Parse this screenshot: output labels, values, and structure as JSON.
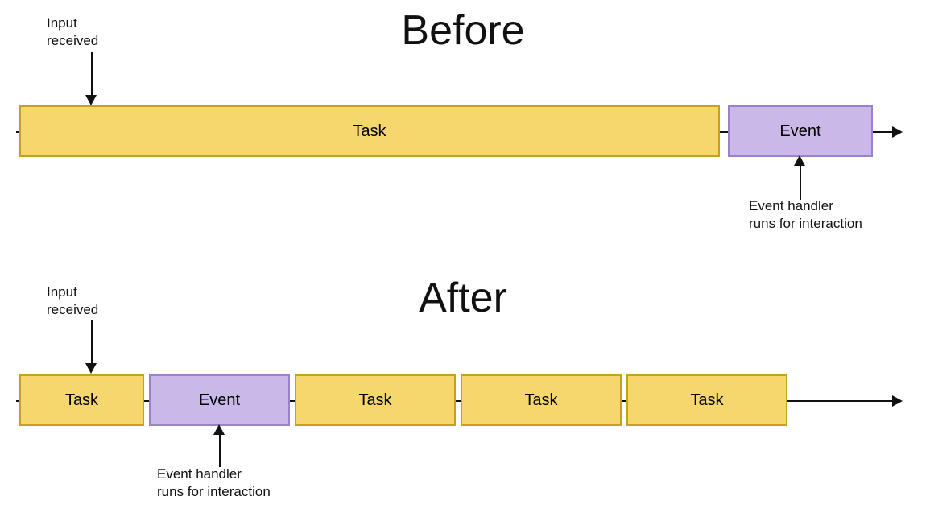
{
  "before": {
    "title": "Before",
    "input_label": "Input\nreceived",
    "task_label": "Task",
    "event_label": "Event",
    "handler_label": "Event handler\nruns for interaction"
  },
  "after": {
    "title": "After",
    "input_label": "Input\nreceived",
    "task1_label": "Task",
    "event_label": "Event",
    "task2_label": "Task",
    "task3_label": "Task",
    "task4_label": "Task",
    "handler_label": "Event handler\nruns for interaction"
  }
}
